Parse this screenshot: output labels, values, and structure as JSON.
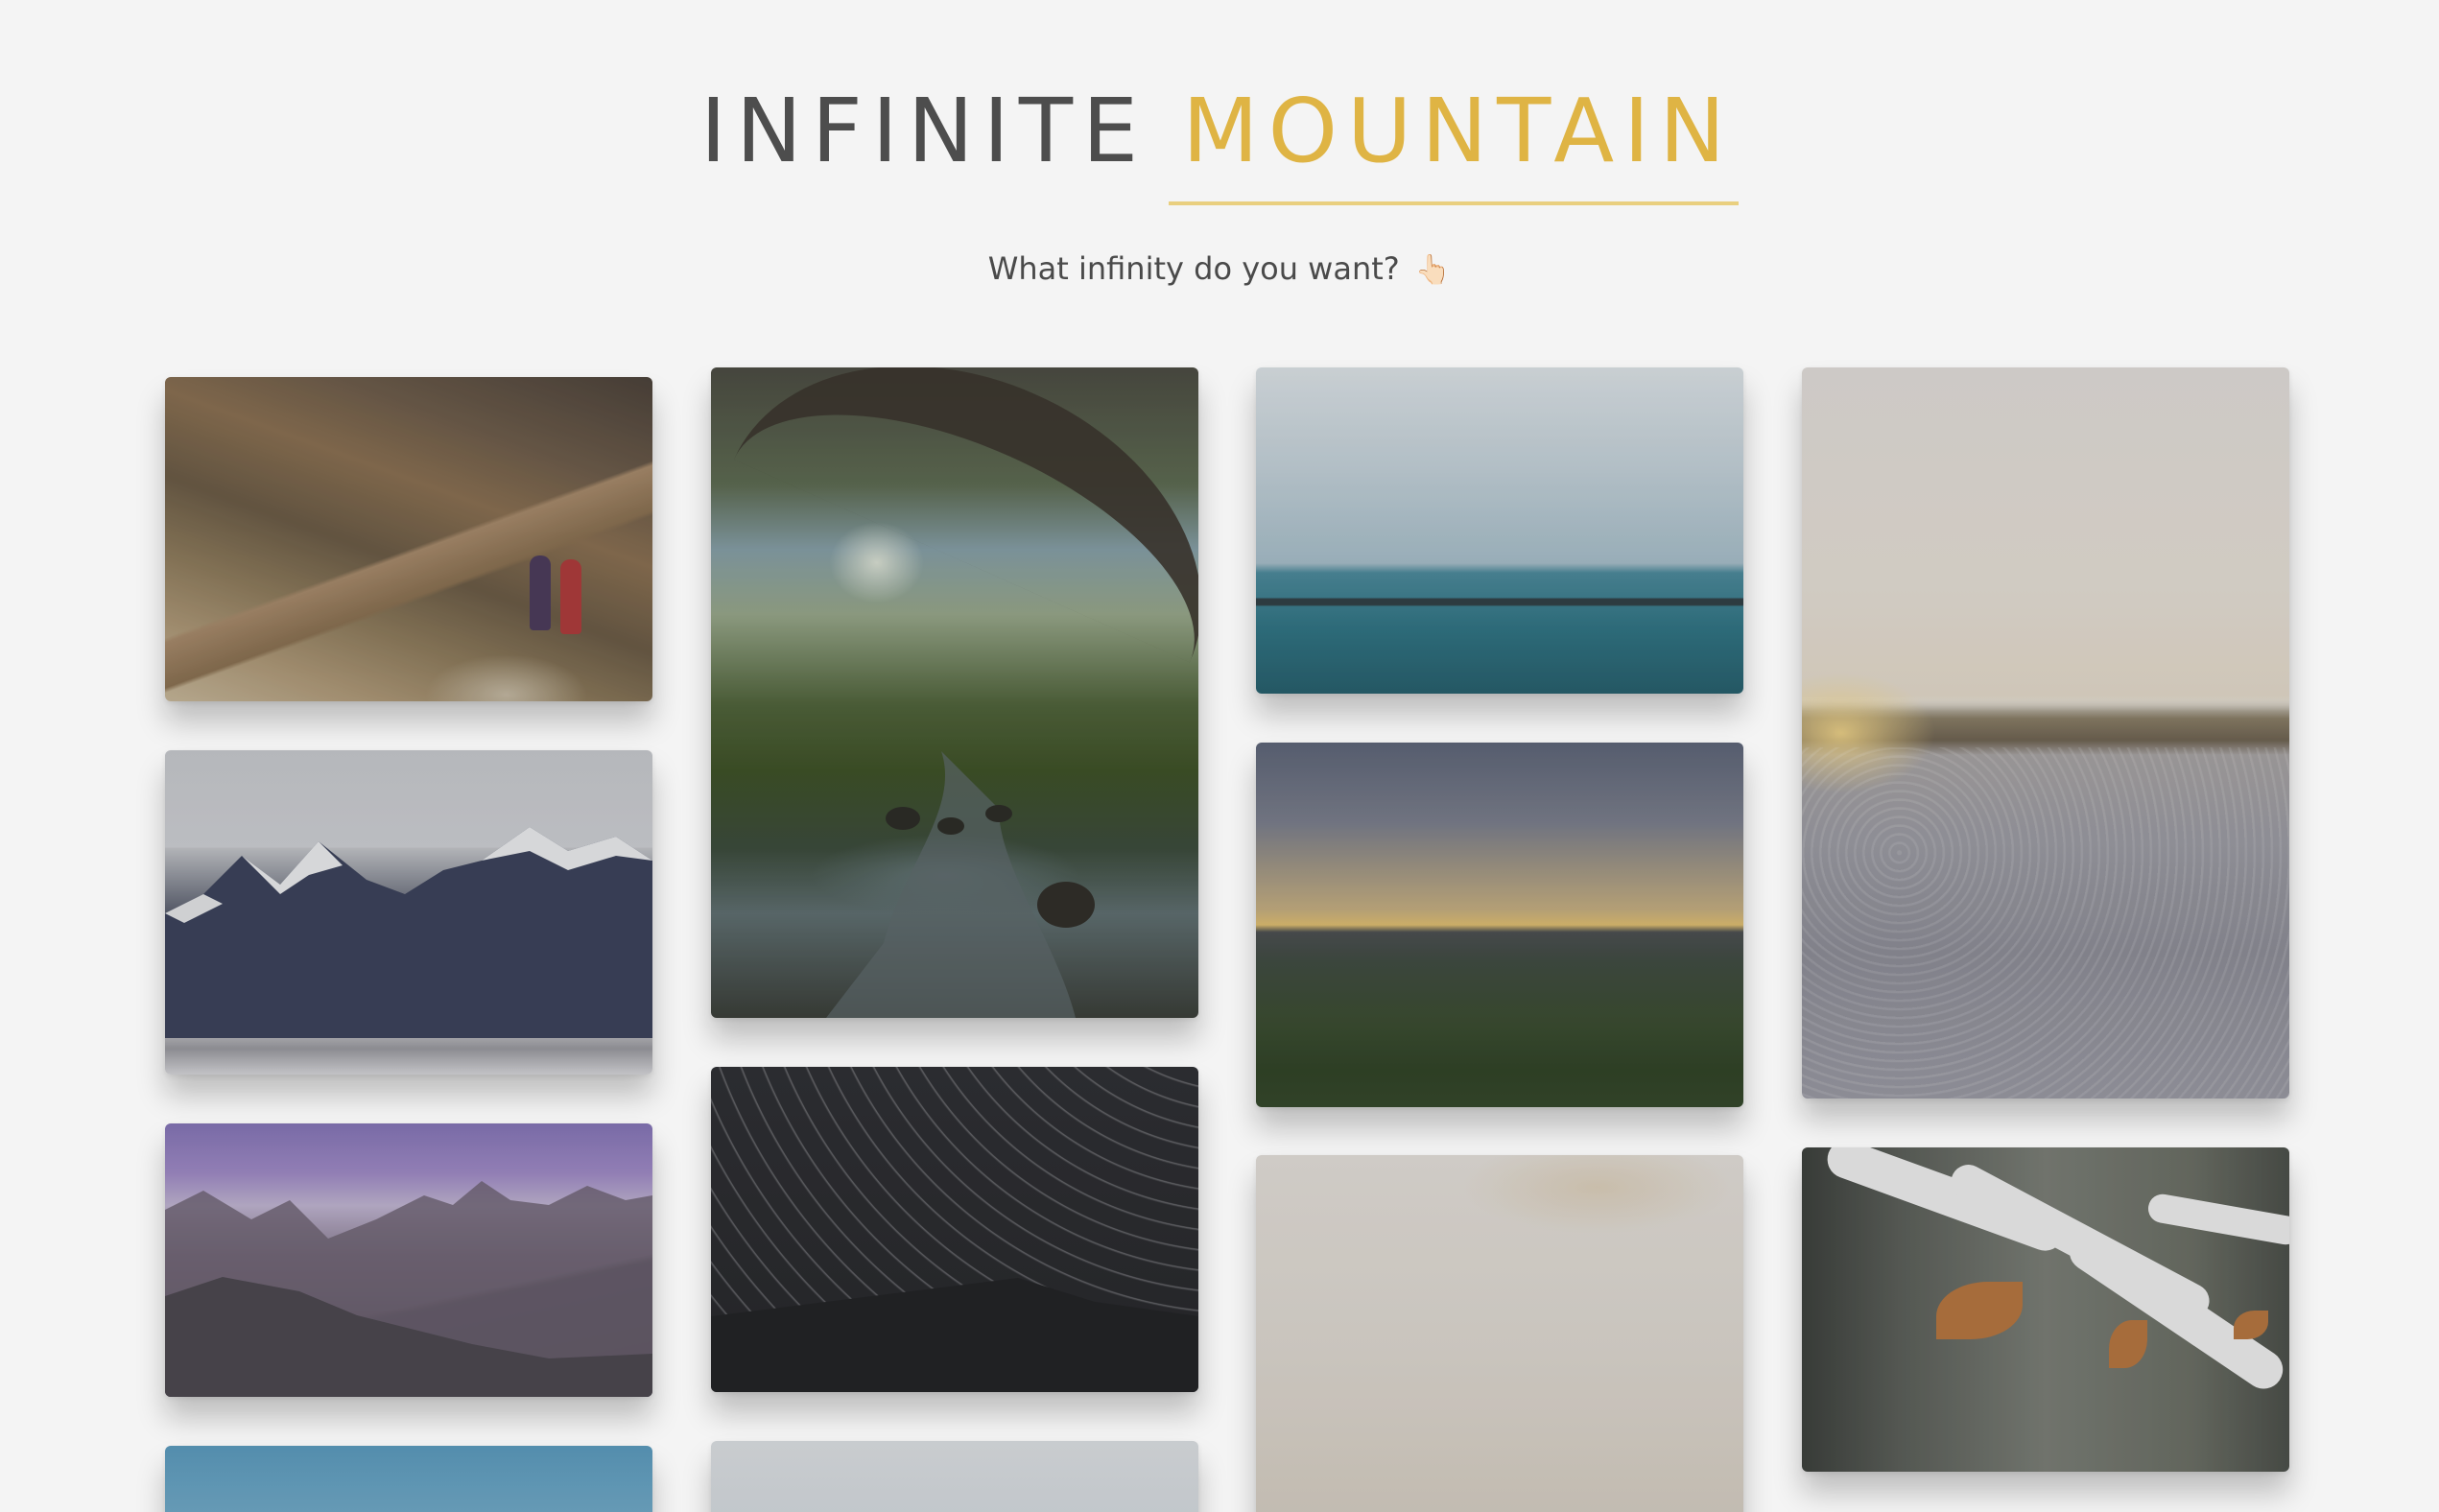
{
  "header": {
    "title_part1": "INFINITE",
    "title_part2": "MOUNTAIN",
    "accent_color": "#dfb444",
    "title_color": "#4d4d4d"
  },
  "tagline": {
    "text": "What infinity do you want?",
    "icon": "pointing-up-hand-icon",
    "glyph": "👆🏻"
  },
  "gallery": {
    "columns": [
      {
        "photos": [
          {
            "subject": "hikers-on-mountain-trail"
          },
          {
            "subject": "snowy-mountain-range"
          },
          {
            "subject": "purple-mountain-peaks"
          },
          {
            "subject": "blue-sky"
          }
        ]
      },
      {
        "photos": [
          {
            "subject": "forest-river"
          },
          {
            "subject": "star-trails"
          },
          {
            "subject": "pale-sky"
          }
        ]
      },
      {
        "photos": [
          {
            "subject": "calm-sea-with-rocks"
          },
          {
            "subject": "sunset-over-town"
          },
          {
            "subject": "sunset-beach"
          }
        ]
      },
      {
        "photos": [
          {
            "subject": "snowy-beach-at-sunrise"
          },
          {
            "subject": "snow-covered-branch-with-leaves"
          }
        ]
      }
    ]
  }
}
